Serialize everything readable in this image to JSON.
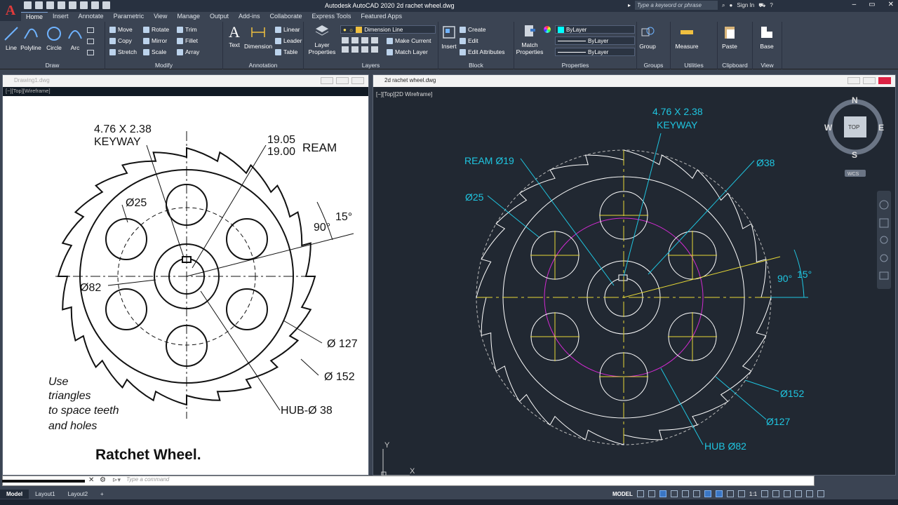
{
  "app": {
    "logo": "A",
    "title": "Autodesk AutoCAD 2020    2d rachet wheel.dwg",
    "search_placeholder": "Type a keyword or phrase",
    "sign_in": "Sign In"
  },
  "ribbon_tabs": [
    "Home",
    "Insert",
    "Annotate",
    "Parametric",
    "View",
    "Manage",
    "Output",
    "Add-ins",
    "Collaborate",
    "Express Tools",
    "Featured Apps"
  ],
  "ribbon": {
    "draw": {
      "title": "Draw",
      "line": "Line",
      "polyline": "Polyline",
      "circle": "Circle",
      "arc": "Arc"
    },
    "modify": {
      "title": "Modify",
      "move": "Move",
      "rotate": "Rotate",
      "trim": "Trim",
      "copy": "Copy",
      "mirror": "Mirror",
      "fillet": "Fillet",
      "stretch": "Stretch",
      "scale": "Scale",
      "array": "Array"
    },
    "annotation": {
      "title": "Annotation",
      "text": "Text",
      "dimension": "Dimension",
      "linear": "Linear",
      "leader": "Leader",
      "table": "Table"
    },
    "layers": {
      "title": "Layers",
      "layer_properties": "Layer Properties",
      "current_layer": "Dimension Line",
      "make_current": "Make Current",
      "match_layer": "Match Layer"
    },
    "block": {
      "title": "Block",
      "insert": "Insert",
      "create": "Create",
      "edit": "Edit",
      "edit_attributes": "Edit Attributes"
    },
    "properties": {
      "title": "Properties",
      "match_properties": "Match Properties",
      "color": "ByLayer",
      "linetype": "ByLayer",
      "lineweight": "ByLayer"
    },
    "groups": {
      "title": "Groups",
      "group": "Group"
    },
    "utilities": {
      "title": "Utilities",
      "measure": "Measure"
    },
    "clipboard": {
      "title": "Clipboard",
      "paste": "Paste"
    },
    "view": {
      "title": "View",
      "base": "Base"
    }
  },
  "left_viewport": {
    "file": "Drawing1.dwg",
    "label": "[−][Top][Wireframe]",
    "notes": {
      "keyway": "4.76 X 2.38",
      "keyway2": "KEYWAY",
      "ream1": "19.05",
      "ream2": "19.00",
      "ream3": "REAM",
      "d25": "Ø25",
      "d82": "Ø82",
      "angle90": "90°",
      "angle15": "15°",
      "d127": "Ø 127",
      "d152": "Ø 152",
      "hub": "HUB-Ø 38",
      "use1": "Use",
      "use2": "triangles",
      "use3": "to space teeth",
      "use4": "and holes",
      "title": "Ratchet Wheel."
    }
  },
  "right_viewport": {
    "file": "2d rachet wheel.dwg",
    "label": "[−][Top][2D Wireframe]",
    "labels": {
      "keyway1": "4.76 X 2.38",
      "keyway2": "KEYWAY",
      "ream": "REAM Ø19",
      "d38": "Ø38",
      "d25": "Ø25",
      "angle90": "90°",
      "angle15": "15°",
      "d152": "Ø152",
      "d127": "Ø127",
      "hub": "HUB Ø82"
    },
    "viewcube": {
      "n": "N",
      "s": "S",
      "e": "E",
      "w": "W",
      "top": "TOP",
      "wcs": "WCS"
    },
    "ucs": {
      "x": "X",
      "y": "Y"
    }
  },
  "command": {
    "placeholder": "Type a command"
  },
  "status": {
    "tabs": [
      "Model",
      "Layout1",
      "Layout2"
    ],
    "model": "MODEL",
    "scale": "1:1"
  }
}
